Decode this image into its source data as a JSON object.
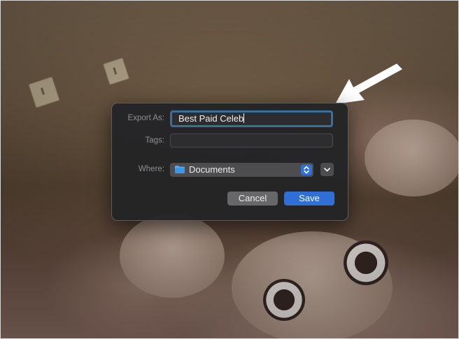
{
  "dialog": {
    "export_as_label": "Export As:",
    "export_as_value": "Best Paid Celeb",
    "tags_label": "Tags:",
    "tags_value": "",
    "where_label": "Where:",
    "where_value": "Documents",
    "cancel_label": "Cancel",
    "save_label": "Save"
  },
  "icons": {
    "folder": "folder-icon",
    "stepper": "up-down-chevron-icon",
    "expand": "chevron-down-icon",
    "annotation": "arrow-icon"
  },
  "colors": {
    "accent": "#2f6fd6",
    "focus_ring": "#3a6e9c",
    "dialog_bg": "#242426",
    "arrow": "#ffffff"
  }
}
